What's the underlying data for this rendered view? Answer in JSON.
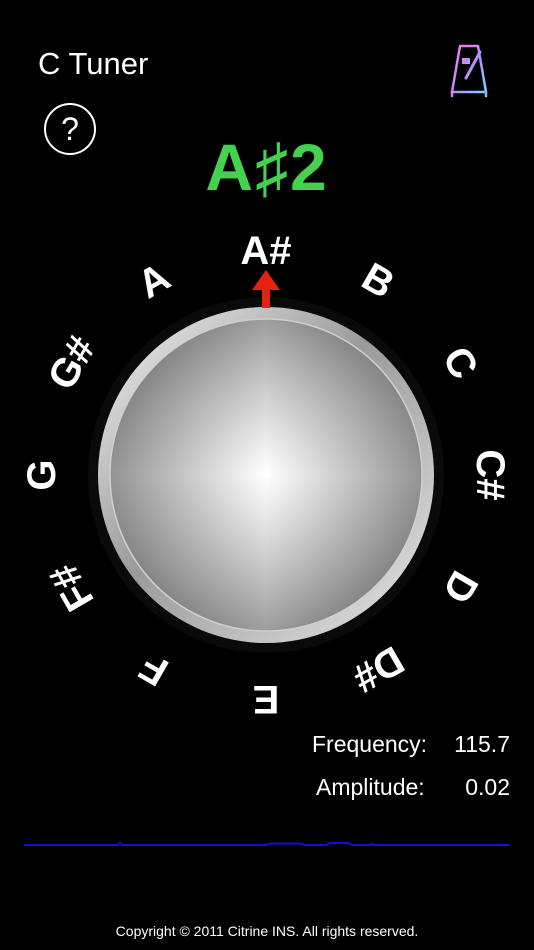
{
  "app": {
    "title": "C Tuner",
    "help_label": "?"
  },
  "tuner": {
    "detected_note": "A♯2",
    "active_note": "A#",
    "note_ring": [
      "A#",
      "B",
      "C",
      "C#",
      "D",
      "D#",
      "E",
      "F",
      "F#",
      "G",
      "G#",
      "A"
    ],
    "frequency_label": "Frequency:",
    "frequency_value": "115.7",
    "amplitude_label": "Amplitude:",
    "amplitude_value": "0.02"
  },
  "waveform": {
    "color": "#1010d8"
  },
  "colors": {
    "note_display": "#44d14f",
    "pointer": "#e82010",
    "background": "#000000"
  },
  "footer": {
    "copyright": "Copyright © 2011 Citrine INS. All rights reserved."
  }
}
